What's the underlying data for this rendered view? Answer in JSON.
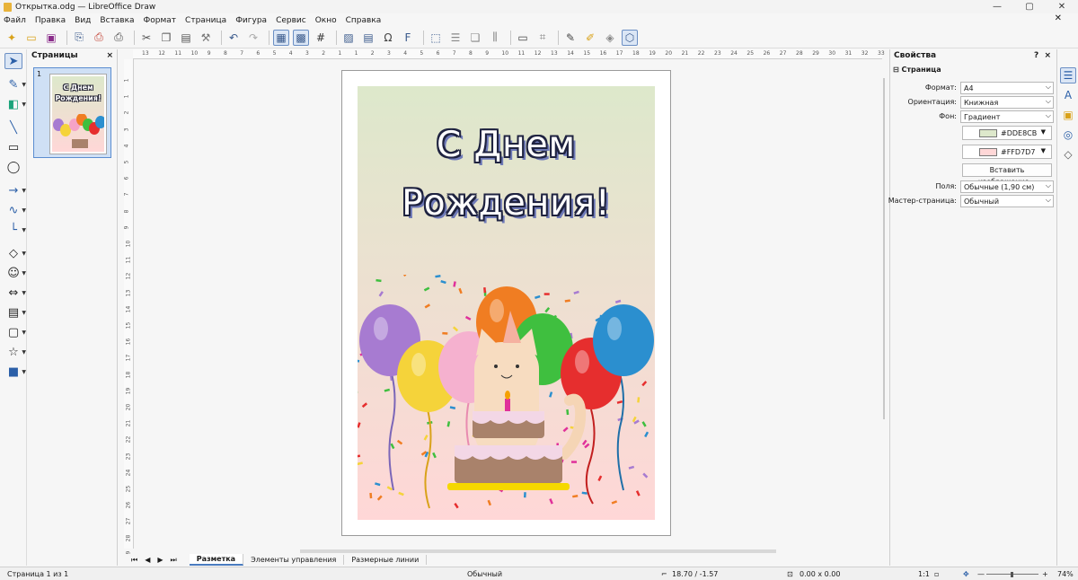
{
  "window": {
    "title": "Открытка.odg — LibreOffice Draw",
    "controls": [
      "—",
      "▢",
      "✕"
    ]
  },
  "menu": [
    "Файл",
    "Правка",
    "Вид",
    "Вставка",
    "Формат",
    "Страница",
    "Фигура",
    "Сервис",
    "Окно",
    "Справка"
  ],
  "toolbar_icons": [
    "new-icon",
    "open-icon",
    "save-icon",
    "export-icon",
    "export-pdf-icon",
    "print-icon",
    "cut-icon",
    "copy-icon",
    "paste-icon",
    "clone-formatting-icon",
    "undo-icon",
    "redo-icon",
    "grid-icon",
    "helplines-icon",
    "snap-grid-icon",
    "image-icon",
    "textbox-icon",
    "special-char-icon",
    "fontwork-icon",
    "transformations-icon",
    "align-icon",
    "arrange-icon",
    "distribute-icon",
    "shadow-icon",
    "crop-icon",
    "points-icon",
    "glue-points-icon",
    "toggle-extrusion-icon",
    "select-shapes-icon"
  ],
  "pages_panel": {
    "title": "Страницы",
    "close": "×",
    "items": [
      {
        "number": "1",
        "text_line1": "С Днем",
        "text_line2": "Рождения!"
      }
    ]
  },
  "card": {
    "line1": "С Днем",
    "line2": "Рождения!"
  },
  "ruler": {
    "h_labels": [
      "13",
      "12",
      "11",
      "10",
      "9",
      "8",
      "7",
      "6",
      "5",
      "4",
      "3",
      "2",
      "1",
      "1",
      "2",
      "3",
      "4",
      "5",
      "6",
      "7",
      "8",
      "9",
      "10",
      "11",
      "12",
      "13",
      "14",
      "15",
      "16",
      "17",
      "18",
      "19",
      "20",
      "21",
      "22",
      "23",
      "24",
      "25",
      "26",
      "27",
      "28",
      "29",
      "30",
      "31",
      "32",
      "33"
    ],
    "v_labels": [
      "1",
      "1",
      "2",
      "3",
      "4",
      "5",
      "6",
      "7",
      "8",
      "9",
      "10",
      "11",
      "12",
      "13",
      "14",
      "15",
      "16",
      "17",
      "18",
      "19",
      "20",
      "21",
      "22",
      "23",
      "24",
      "25",
      "26",
      "27",
      "28",
      "29"
    ]
  },
  "tabs": {
    "items": [
      "Разметка",
      "Элементы управления",
      "Размерные линии"
    ],
    "active": "Разметка",
    "nav": [
      "⏮",
      "◀",
      "▶",
      "⏭"
    ]
  },
  "properties": {
    "title": "Свойства",
    "help": "?",
    "close": "×",
    "section": "Страница",
    "rows": [
      {
        "label": "Формат:",
        "value": "A4"
      },
      {
        "label": "Ориентация:",
        "value": "Книжная"
      },
      {
        "label": "Фон:",
        "value": "Градиент"
      }
    ],
    "colors": [
      {
        "hex": "#DDE8CB",
        "label": "#DDE8CB"
      },
      {
        "hex": "#FFD7D7",
        "label": "#FFD7D7"
      }
    ],
    "insert_image": "Вставить изображение...",
    "rows2": [
      {
        "label": "Поля:",
        "value": "Обычные (1,90 см)"
      },
      {
        "label": "Мастер-страница:",
        "value": "Обычный"
      }
    ]
  },
  "status": {
    "page": "Страница 1 из 1",
    "style": "Обычный",
    "position": "18.70 / -1.57",
    "size": "0.00 x 0.00",
    "ratio": "1:1",
    "zoom": "74%"
  }
}
